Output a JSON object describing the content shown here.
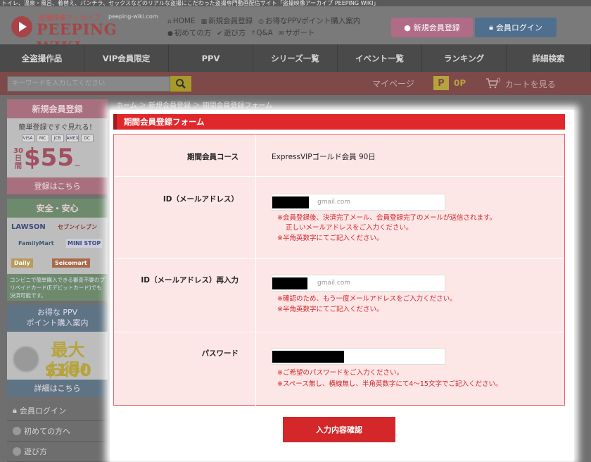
{
  "topbar_text": "トイレ、温泉・風呂、着替え、パンチラ、セックスなどのリアルな盗撮にこだわった盗撮専門動画配信サイト「盗撮映像アーカイブ PEEPING WIKI」",
  "logo": {
    "sub": "盗撮映像アーカイブ",
    "url": "peeping-wiki.com",
    "name": "PEEPING WIKI"
  },
  "toplinks": {
    "row1": [
      "HOME",
      "新規会員登録",
      "お得なPPVポイント購入案内"
    ],
    "row2": [
      "初めての方",
      "遊び方",
      "Q&A",
      "サポート"
    ]
  },
  "buttons": {
    "register": "新規会員登録",
    "login": "会員ログイン"
  },
  "nav": [
    "全盗撮作品",
    "VIP会員限定",
    "PPV",
    "シリーズ一覧",
    "イベント一覧",
    "ランキング",
    "詳細検索"
  ],
  "search": {
    "placeholder": "キーワードを入力してください"
  },
  "account": {
    "mypage": "マイページ",
    "points_icon": "P",
    "points": "0P",
    "cart_count": "0",
    "cart": "カートを見る"
  },
  "sidebar": {
    "register": {
      "title": "新規会員登録",
      "line1": "簡単登録ですぐ見れる！",
      "cards": [
        "VISA",
        "MC",
        "JCB",
        "AMEX",
        "DC"
      ],
      "days_top": "30",
      "days_bottom": "日間",
      "price": "$55",
      "price_suffix": "~",
      "link": "登録はこちら"
    },
    "safe": {
      "title": "安全・安心",
      "stores": [
        "LAWSON",
        "セブンイレブン",
        "FamilyMart",
        "MINI STOP",
        "Daily",
        "Seicomart"
      ],
      "note": "コンビニで簡単購入できる審査不要のプリペイドカード(Eデビットカード)でも決済可能です。"
    },
    "ppv": {
      "title_line1": "お得な PPV",
      "title_line2": "ポイント購入案内",
      "big1": "最大$100",
      "big2": "お得!",
      "link": "詳細はこちら"
    },
    "menu": [
      "会員ログイン",
      "初めての方へ",
      "遊び方"
    ]
  },
  "breadcrumb": "ホーム ＞ 新規会員登録 ＞ 期間会員登録フォーム",
  "form": {
    "title": "期間会員登録フォーム",
    "course_label": "期間会員コース",
    "course_value": "ExpressVIPゴールド会員 90日",
    "id_label": "ID（メールアドレス）",
    "id_value": "gmail.com",
    "id_note1": "※会員登録後、決済完了メール、会員登録完了のメールが送信されます。",
    "id_note2": "正しいメールアドレスをご入力ください。",
    "id_note3": "※半角英数字にてご記入ください。",
    "id2_label": "ID（メールアドレス）再入力",
    "id2_value": "gmail.com",
    "id2_note1": "※確認のため、もう一度メールアドレスをご入力ください。",
    "id2_note2": "※半角英数字にてご記入ください。",
    "pw_label": "パスワード",
    "pw_note1": "※ご希望のパスワードをご入力ください。",
    "pw_note2": "※スペース無し、横線無し、半角英数字にて4～15文字でご記入ください。",
    "submit": "入力内容確認"
  }
}
